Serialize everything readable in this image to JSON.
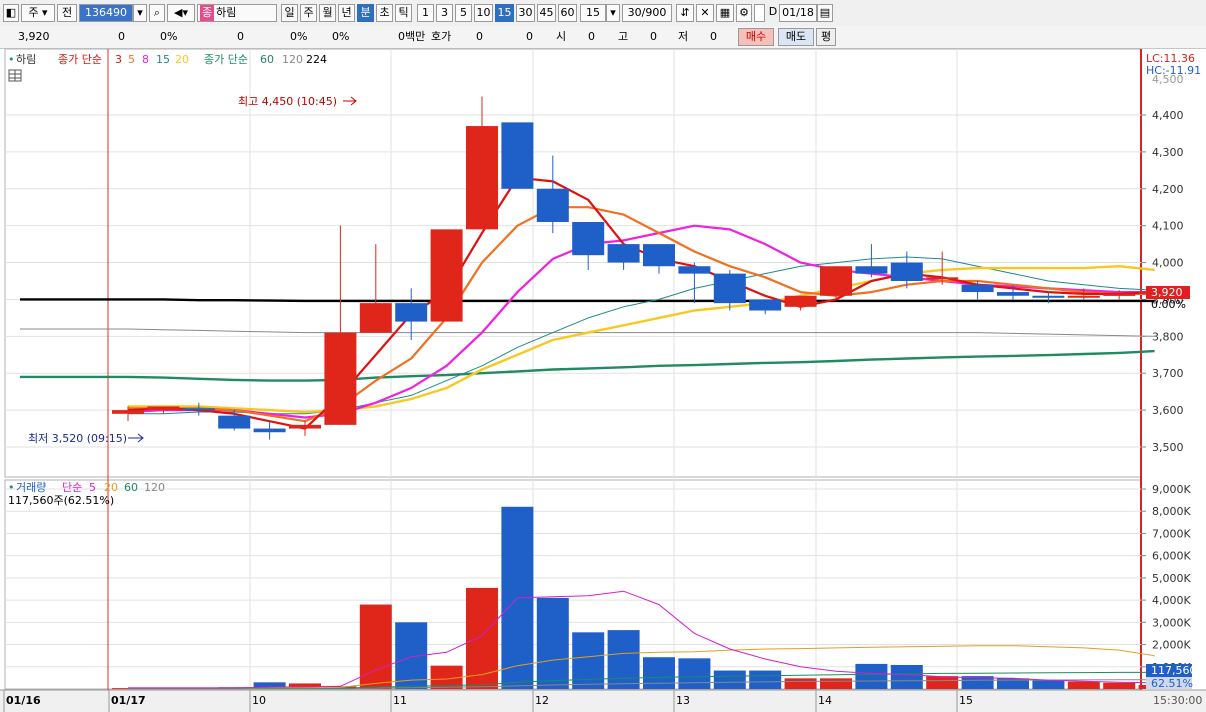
{
  "toolbar": {
    "market_tab": "주",
    "mode_tab": "전",
    "code": "136490",
    "name_badge": "종",
    "name": "하림",
    "period_tabs": [
      "일",
      "주",
      "월",
      "년",
      "분",
      "초",
      "틱"
    ],
    "selected_period": "분",
    "intervals": [
      "1",
      "3",
      "5",
      "10",
      "15",
      "30",
      "45",
      "60"
    ],
    "selected_interval": "15",
    "interval_value": "15",
    "count": "30/900",
    "checkbox_label": "D",
    "date": "01/18"
  },
  "quote": {
    "price": "3,920",
    "change": "0",
    "change_rate": "0%",
    "volume": "0",
    "volume_rate": "0%",
    "rate2": "0%",
    "amount": "0백만",
    "bid_label": "호가",
    "bid_val1": "0",
    "bid_val2": "0",
    "open_label": "시",
    "open": "0",
    "high_label": "고",
    "high": "0",
    "low_label": "저",
    "low": "0",
    "buy_button": "매수",
    "sell_button": "매도",
    "eval_button": "평"
  },
  "price_legend": {
    "name": "하림",
    "ma1_label": "종가 단순",
    "ma1_periods": [
      "3",
      "5",
      "8",
      "15",
      "20"
    ],
    "ma2_label": "종가 단순",
    "ma2_periods": [
      "60",
      "120",
      "224"
    ]
  },
  "volume_legend": {
    "label": "거래량",
    "ma_label": "단순",
    "periods": [
      "5",
      "20",
      "60",
      "120"
    ],
    "current": "117,560주(62.51%)"
  },
  "annotations": {
    "high": "최고 4,450 (10:45)",
    "low": "최저 3,520 (09:15)",
    "lc": "LC:11.36",
    "hc": "HC:-11.91",
    "price_tag": "3,920",
    "pct_tag": "0.00%",
    "vol_tag": "117,560",
    "vol_pct_tag": "62.51%",
    "end_time": "15:30:00",
    "top_cut_label": "4,500"
  },
  "colors": {
    "up": "#e0261a",
    "down": "#1e5fc8",
    "ma3": "#e01010",
    "ma5": "#f07020",
    "ma8": "#f020e0",
    "ma15": "#1e8a8a",
    "ma20": "#f8c820",
    "ma60": "#208a60",
    "ma120": "#888888",
    "ma224": "#000000"
  },
  "chart_data": [
    {
      "type": "candlestick",
      "title": "하림 15분",
      "x_labels": [
        "01/16",
        "01/17",
        "10",
        "11",
        "12",
        "13",
        "14",
        "15"
      ],
      "y_ticks": [
        3500,
        3600,
        3700,
        3800,
        3900,
        4000,
        4100,
        4200,
        4300,
        4400
      ],
      "ylim": [
        3450,
        4500
      ],
      "candles": [
        {
          "o": 3590,
          "h": 3610,
          "l": 3570,
          "c": 3600
        },
        {
          "o": 3600,
          "h": 3610,
          "l": 3590,
          "c": 3610
        },
        {
          "o": 3605,
          "h": 3620,
          "l": 3585,
          "c": 3600
        },
        {
          "o": 3585,
          "h": 3600,
          "l": 3545,
          "c": 3550
        },
        {
          "o": 3550,
          "h": 3570,
          "l": 3520,
          "c": 3540
        },
        {
          "o": 3550,
          "h": 3570,
          "l": 3530,
          "c": 3560
        },
        {
          "o": 3560,
          "h": 4100,
          "l": 3560,
          "c": 3810
        },
        {
          "o": 3810,
          "h": 4050,
          "l": 3810,
          "c": 3890
        },
        {
          "o": 3890,
          "h": 3930,
          "l": 3790,
          "c": 3840
        },
        {
          "o": 3840,
          "h": 4070,
          "l": 3840,
          "c": 4090
        },
        {
          "o": 4090,
          "h": 4450,
          "l": 4090,
          "c": 4370
        },
        {
          "o": 4380,
          "h": 4380,
          "l": 4200,
          "c": 4200
        },
        {
          "o": 4200,
          "h": 4290,
          "l": 4080,
          "c": 4110
        },
        {
          "o": 4110,
          "h": 4110,
          "l": 3980,
          "c": 4020
        },
        {
          "o": 4050,
          "h": 4050,
          "l": 3980,
          "c": 4000
        },
        {
          "o": 4050,
          "h": 4050,
          "l": 3970,
          "c": 3990
        },
        {
          "o": 3990,
          "h": 4000,
          "l": 3890,
          "c": 3970
        },
        {
          "o": 3970,
          "h": 3980,
          "l": 3870,
          "c": 3890
        },
        {
          "o": 3900,
          "h": 3900,
          "l": 3860,
          "c": 3870
        },
        {
          "o": 3880,
          "h": 3910,
          "l": 3870,
          "c": 3910
        },
        {
          "o": 3910,
          "h": 3990,
          "l": 3900,
          "c": 3990
        },
        {
          "o": 3990,
          "h": 4050,
          "l": 3960,
          "c": 3970
        },
        {
          "o": 4000,
          "h": 4030,
          "l": 3930,
          "c": 3950
        },
        {
          "o": 3960,
          "h": 4030,
          "l": 3940,
          "c": 3960
        },
        {
          "o": 3940,
          "h": 3950,
          "l": 3900,
          "c": 3920
        },
        {
          "o": 3920,
          "h": 3940,
          "l": 3900,
          "c": 3910
        },
        {
          "o": 3910,
          "h": 3920,
          "l": 3890,
          "c": 3905
        },
        {
          "o": 3905,
          "h": 3930,
          "l": 3900,
          "c": 3910
        },
        {
          "o": 3910,
          "h": 3925,
          "l": 3900,
          "c": 3915
        },
        {
          "o": 3915,
          "h": 3930,
          "l": 3905,
          "c": 3920
        }
      ],
      "moving_averages": {
        "ma3": [
          3600,
          3605,
          3600,
          3590,
          3570,
          3550,
          3640,
          3750,
          3860,
          3920,
          4080,
          4230,
          4220,
          4170,
          4050,
          4010,
          3990,
          3950,
          3910,
          3880,
          3900,
          3950,
          3970,
          3960,
          3940,
          3930,
          3920,
          3915,
          3915,
          3920
        ],
        "ma5": [
          3605,
          3605,
          3605,
          3600,
          3585,
          3570,
          3610,
          3680,
          3740,
          3850,
          4000,
          4100,
          4150,
          4150,
          4130,
          4080,
          4030,
          3990,
          3960,
          3920,
          3910,
          3920,
          3940,
          3950,
          3950,
          3940,
          3930,
          3920,
          3915,
          3915
        ],
        "ma8": [
          3595,
          3600,
          3600,
          3600,
          3590,
          3580,
          3590,
          3620,
          3660,
          3720,
          3810,
          3920,
          4010,
          4050,
          4060,
          4080,
          4100,
          4090,
          4050,
          4000,
          3980,
          3970,
          3960,
          3950,
          3940,
          3935,
          3930,
          3925,
          3920,
          3920
        ],
        "ma15": [
          3590,
          3590,
          3595,
          3595,
          3590,
          3590,
          3600,
          3620,
          3640,
          3680,
          3720,
          3770,
          3810,
          3850,
          3880,
          3900,
          3930,
          3950,
          3970,
          3990,
          4000,
          4010,
          4015,
          4010,
          3990,
          3970,
          3950,
          3940,
          3930,
          3925
        ],
        "ma20": [
          3610,
          3610,
          3610,
          3605,
          3600,
          3595,
          3600,
          3610,
          3630,
          3660,
          3710,
          3750,
          3790,
          3810,
          3830,
          3850,
          3870,
          3880,
          3890,
          3910,
          3930,
          3950,
          3970,
          3980,
          3985,
          3985,
          3985,
          3985,
          3990,
          3980
        ],
        "ma60": [
          3690,
          3688,
          3685,
          3682,
          3680,
          3680,
          3682,
          3688,
          3692,
          3695,
          3700,
          3705,
          3710,
          3713,
          3716,
          3720,
          3722,
          3725,
          3728,
          3730,
          3733,
          3737,
          3740,
          3743,
          3745,
          3747,
          3749,
          3752,
          3755,
          3760
        ],
        "ma120": [
          3820,
          3818,
          3816,
          3814,
          3812,
          3810,
          3810,
          3810,
          3810,
          3810,
          3810,
          3810,
          3810,
          3810,
          3810,
          3810,
          3810,
          3810,
          3810,
          3810,
          3810,
          3810,
          3810,
          3810,
          3810,
          3808,
          3806,
          3804,
          3802,
          3800
        ],
        "ma224": [
          3900,
          3900,
          3898,
          3898,
          3897,
          3896,
          3896,
          3896,
          3896,
          3896,
          3896,
          3896,
          3896,
          3896,
          3896,
          3896,
          3896,
          3896,
          3896,
          3896,
          3896,
          3896,
          3896,
          3896,
          3896,
          3896,
          3896,
          3896,
          3896,
          3896
        ]
      }
    },
    {
      "type": "bar",
      "title": "거래량",
      "y_ticks": [
        "1,000K",
        "2,000K",
        "3,000K",
        "4,000K",
        "5,000K",
        "6,000K",
        "7,000K",
        "8,000K",
        "9,000K"
      ],
      "ylim": [
        0,
        9000
      ],
      "volumes": [
        40,
        50,
        60,
        80,
        300,
        250,
        120,
        3800,
        3000,
        1050,
        4550,
        8200,
        4100,
        2550,
        2650,
        1430,
        1380,
        830,
        830,
        480,
        480,
        1130,
        1080,
        580,
        580,
        480,
        380,
        330,
        280,
        180
      ],
      "volume_ma5": [
        50,
        50,
        50,
        50,
        80,
        100,
        120,
        850,
        1450,
        1650,
        2400,
        4100,
        4150,
        4200,
        4400,
        3800,
        2500,
        1800,
        1350,
        1000,
        800,
        700,
        650,
        550,
        500,
        480,
        400,
        350,
        300,
        280
      ],
      "volume_ma20": [
        50,
        50,
        50,
        50,
        55,
        60,
        70,
        250,
        400,
        450,
        650,
        1050,
        1300,
        1450,
        1600,
        1650,
        1680,
        1750,
        1800,
        1820,
        1850,
        1880,
        1900,
        1920,
        1950,
        1950,
        1900,
        1850,
        1750,
        1500
      ],
      "volume_ma60": [
        30,
        30,
        30,
        30,
        35,
        35,
        40,
        80,
        120,
        150,
        200,
        300,
        380,
        430,
        480,
        520,
        550,
        580,
        600,
        620,
        640,
        660,
        680,
        700,
        710,
        720,
        730,
        740,
        745,
        750
      ],
      "volume_ma120": [
        20,
        20,
        20,
        20,
        22,
        22,
        24,
        40,
        60,
        80,
        100,
        140,
        180,
        210,
        240,
        260,
        280,
        300,
        320,
        340,
        350,
        360,
        370,
        380,
        390,
        400,
        405,
        410,
        415,
        420
      ]
    }
  ]
}
